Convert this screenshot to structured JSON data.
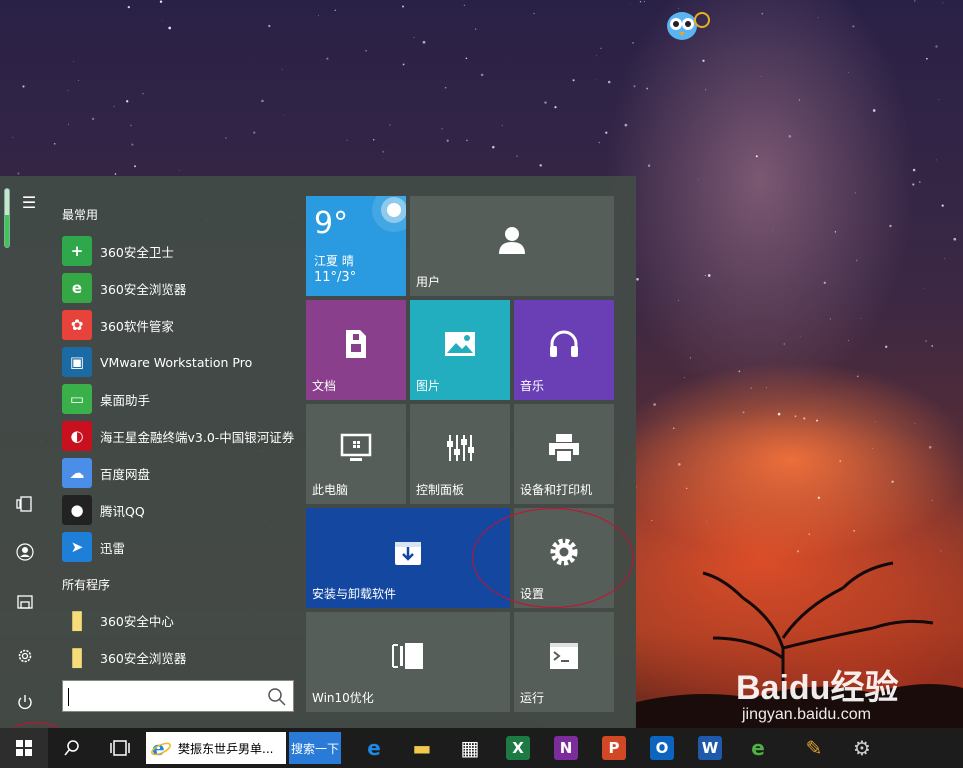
{
  "start_menu": {
    "frequent_title": "最常用",
    "all_programs_title": "所有程序",
    "frequent_apps": [
      {
        "label": "360安全卫士",
        "icon": "shield-plus-icon",
        "color": "#2ea84a"
      },
      {
        "label": "360安全浏览器",
        "icon": "browser-e-icon",
        "color": "#35a845"
      },
      {
        "label": "360软件管家",
        "icon": "colorful-grid-icon",
        "color": "#e8433a"
      },
      {
        "label": "VMware Workstation Pro",
        "icon": "vmware-icon",
        "color": "#1c6aa3"
      },
      {
        "label": "桌面助手",
        "icon": "desktop-monitor-icon",
        "color": "#3ab04a"
      },
      {
        "label": "海王星金融终端v3.0-中国银河证券",
        "icon": "swirl-logo-icon",
        "color": "#c8101e"
      },
      {
        "label": "百度网盘",
        "icon": "cloud-icon",
        "color": "#4a8ee8"
      },
      {
        "label": "腾讯QQ",
        "icon": "penguin-icon",
        "color": "#222222"
      },
      {
        "label": "迅雷",
        "icon": "bird-icon",
        "color": "#1e7fd8"
      }
    ],
    "all_programs": [
      {
        "label": "360安全中心",
        "icon": "folder-icon",
        "color": "#f0c84a"
      },
      {
        "label": "360安全浏览器",
        "icon": "folder-icon",
        "color": "#f0c84a"
      }
    ],
    "rail": {
      "menu_glyph": "☰"
    }
  },
  "tiles": {
    "weather": {
      "temp": "9°",
      "city": "江夏  晴",
      "range": "11°/3°",
      "color": "#2a9be0"
    },
    "user": {
      "label": "用户",
      "color": "#565e59"
    },
    "documents": {
      "label": "文档",
      "color": "#8a3f8c"
    },
    "pictures": {
      "label": "图片",
      "color": "#23aec0"
    },
    "music": {
      "label": "音乐",
      "color": "#6a3fb5"
    },
    "this_pc": {
      "label": "此电脑",
      "color": "#565e59"
    },
    "control_panel": {
      "label": "控制面板",
      "color": "#565e59"
    },
    "devices_printers": {
      "label": "设备和打印机",
      "color": "#565e59"
    },
    "install_uninstall": {
      "label": "安装与卸载软件",
      "color": "#1448a0"
    },
    "settings": {
      "label": "设置",
      "color": "#565e59"
    },
    "win10_optimize": {
      "label": "Win10优化",
      "color": "#565e59"
    },
    "run": {
      "label": "运行",
      "color": "#565e59"
    }
  },
  "taskbar": {
    "active_app_title": "樊振东世乒男单...",
    "search_button": "搜索一下",
    "pinned": [
      {
        "icon": "edge-icon",
        "color": "#1e88e5"
      },
      {
        "icon": "file-explorer-icon",
        "color": "#f2c94c"
      },
      {
        "icon": "store-icon",
        "color": "#ffffff"
      },
      {
        "icon": "excel-icon",
        "color": "#1d7a45"
      },
      {
        "icon": "onenote-icon",
        "color": "#7b2d9c"
      },
      {
        "icon": "powerpoint-icon",
        "color": "#d24726"
      },
      {
        "icon": "outlook-icon",
        "color": "#0a64c0"
      },
      {
        "icon": "word-icon",
        "color": "#1f5aaa"
      },
      {
        "icon": "360-browser-icon",
        "color": "#4fb043"
      },
      {
        "icon": "paint-icon",
        "color": "#e0a030"
      },
      {
        "icon": "settings-gear-icon",
        "color": "#cccccc"
      }
    ]
  },
  "watermark": {
    "main": "Baidu经验",
    "sub": "jingyan.baidu.com"
  },
  "annotation_color": "#c8102e"
}
